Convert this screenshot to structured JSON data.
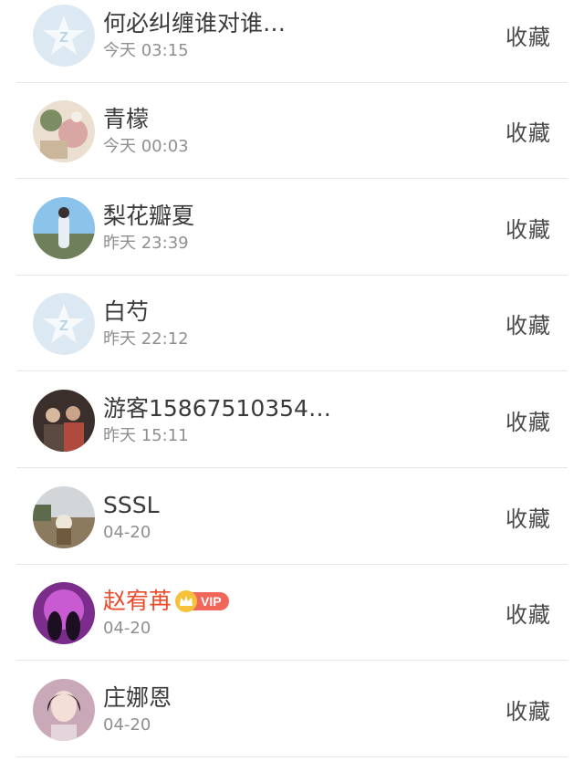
{
  "fav_label": "收藏",
  "items": [
    {
      "name": "何必纠缠谁对谁…",
      "time": "今天 03:15",
      "avatar": "qzone-default-avatar"
    },
    {
      "name": "青檬",
      "time": "今天 00:03",
      "avatar": "photo-avatar"
    },
    {
      "name": "梨花瓣夏",
      "time": "昨天 23:39",
      "avatar": "photo-avatar"
    },
    {
      "name": "白芍",
      "time": "昨天 22:12",
      "avatar": "qzone-default-avatar"
    },
    {
      "name": "游客15867510354…",
      "time": "昨天 15:11",
      "avatar": "photo-avatar"
    },
    {
      "name": "SSSL",
      "time": "04-20",
      "avatar": "photo-avatar"
    },
    {
      "name": "赵宥苒",
      "time": "04-20",
      "avatar": "photo-avatar",
      "vip_label": "VIP"
    },
    {
      "name": "庄娜恩",
      "time": "04-20",
      "avatar": "photo-avatar"
    }
  ],
  "colors": {
    "vip_name": "#ea4b2a",
    "vip_badge": "#f0665a",
    "crown": "#f7c23a"
  }
}
